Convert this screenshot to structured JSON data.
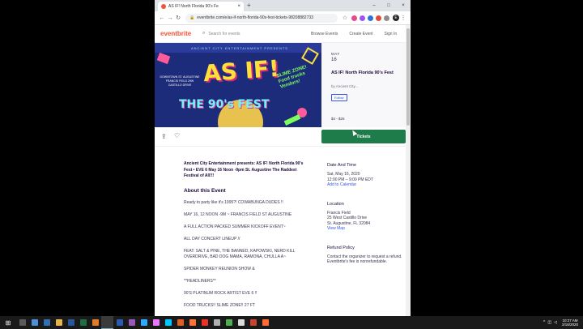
{
  "browser": {
    "tab_title": "AS IF! North Florida 90's Fe",
    "tab_close": "×",
    "new_tab": "+",
    "url": "eventbrite.com/e/as-if-north-florida-90s-fest-tickets-98208882733",
    "window_controls": {
      "minimize": "–",
      "maximize": "□",
      "close": "×"
    },
    "profile_initial": "E",
    "extension_colors": [
      "#e34b8a",
      "#9a56f0",
      "#2a73d8",
      "#e04a3a",
      "#8c8c8c"
    ]
  },
  "header": {
    "logo": "eventbrite",
    "search_placeholder": "Search for events",
    "browse_events": "Browse Events",
    "create_event": "Create Event",
    "sign_in": "Sign In"
  },
  "hero": {
    "presents": "ANCIENT CITY ENTERTAINMENT PRESENTS",
    "headline": "AS IF!",
    "subheadline": "THE 90's FEST",
    "side_text": "DOWNTOWN ST. AUGUSTINE FRANCIS FIELD 29W CASTILLO DRIVE",
    "badge": "SLIME ZONE! Food trucks Vendors!"
  },
  "side_card": {
    "month": "MAY",
    "day": "16",
    "title": "AS IF! North Florida 90's Fest",
    "organizer": "by Ancient City...",
    "follow": "Follow",
    "price": "$4 - $25"
  },
  "actions": {
    "tickets": "Tickets"
  },
  "event": {
    "lead": "Ancient City Entertainment presents: AS IF! North Florida 90's Fest • EVE 6 May 16 Noon -9pm St. Augustine The Raddest Festival of All!!!",
    "about_heading": "About this Event",
    "description": [
      "Ready to party like it's 1995?! COWABUNGA DUDES !!",
      "MAY 16, 12 NOON -9M ~ FRANCIS FIELD ST AUGUSTINE",
      "A FULL ACTION PACKED SUMMER KICKOFF EVENT~",
      "ALL DAY CONCERT LINEUP //",
      "FEAT: SALT & PINE, THE BANNED, KAPOWSKI, NERD KILL OVERDRIVE, BAD DOG MAMA, RAMONA, CHULLA A~",
      "SPIDER MONKEY REUNION SHOW &",
      "**HEADLINERS**",
      "90'S PLATINUM ROCK ARTIST EVE 6 !!",
      "FOOD TRUCKS!! SLIME ZONE!! 27 FT"
    ]
  },
  "details": {
    "date_heading": "Date And Time",
    "date": "Sat, May 16, 2020",
    "time": "12:00 PM – 9:00 PM EDT",
    "add_calendar": "Add to Calendar",
    "location_heading": "Location",
    "venue": "Francis Field",
    "address1": "25 West Castillo Drive",
    "address2": "St. Augustine, FL 32084",
    "view_map": "View Map",
    "refund_heading": "Refund Policy",
    "refund_text": "Contact the organizer to request a refund.",
    "refund_fee": "Eventbrite's fee is nonrefundable."
  },
  "taskbar": {
    "time": "10:27 AM",
    "date": "2/18/2020",
    "icon_colors": [
      "#5a5a5a",
      "#4a90d9",
      "#2f6fb3",
      "#e8b34a",
      "#2b579a",
      "#1d6f42",
      "#e07b2a",
      "#3a3a3a",
      "#2a5db0",
      "#9b59b6",
      "#31a8ff",
      "#ea77ff",
      "#00c8ff",
      "#e35d26",
      "#ff7139",
      "#ee3124",
      "#b0b0b0",
      "#4caf50",
      "#dadada",
      "#c7472e",
      "#ff6b35"
    ]
  }
}
